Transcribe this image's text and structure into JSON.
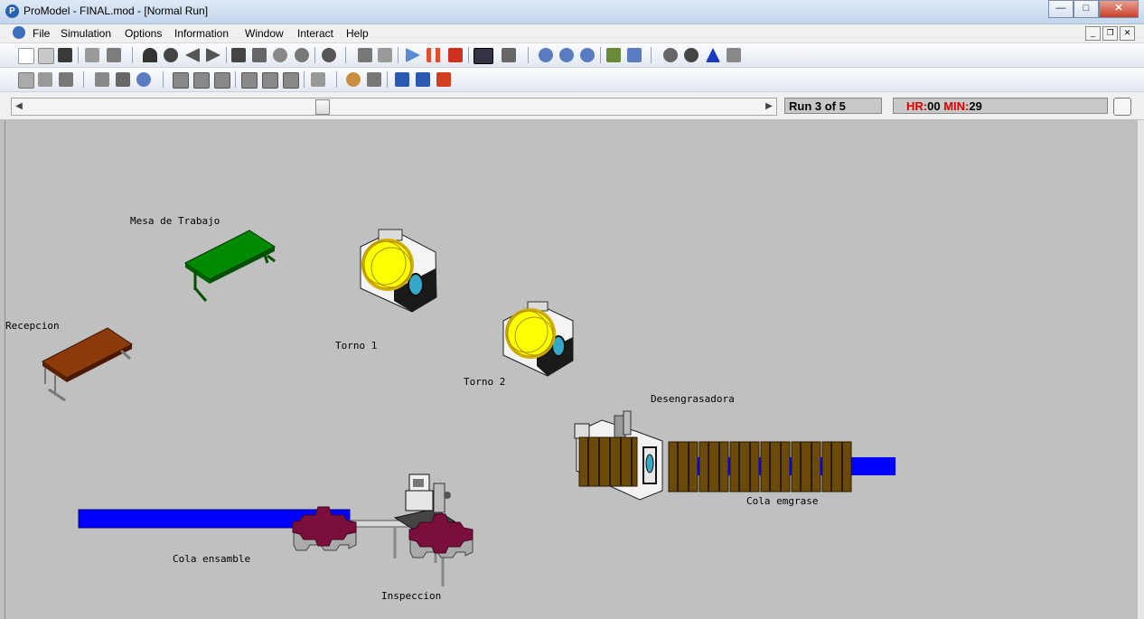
{
  "window": {
    "title": "ProModel - FINAL.mod - [Normal Run]"
  },
  "menu": {
    "items": [
      "File",
      "Simulation",
      "Options",
      "Information",
      "Window",
      "Interact",
      "Help"
    ]
  },
  "status": {
    "run": "Run 3 of 5",
    "hr_label": "HR:",
    "hr_value": "00",
    "min_label": "MIN:",
    "min_value": "29"
  },
  "layout_labels": {
    "mesa": "Mesa de Trabajo",
    "recepcion": "Recepcion",
    "torno1": "Torno 1",
    "torno2": "Torno 2",
    "desengrasadora": "Desengrasadora",
    "cola_emgrase": "Cola emgrase",
    "cola_ensamble": "Cola ensamble",
    "inspeccion": "Inspeccion"
  },
  "colors": {
    "queue_blue": "#0000ff",
    "gear": "#7a0f3c",
    "table_green": "#008a00",
    "table_brown": "#8b3a0a",
    "part_yellow": "#ffff00",
    "pallet": "#6b4a0a"
  }
}
